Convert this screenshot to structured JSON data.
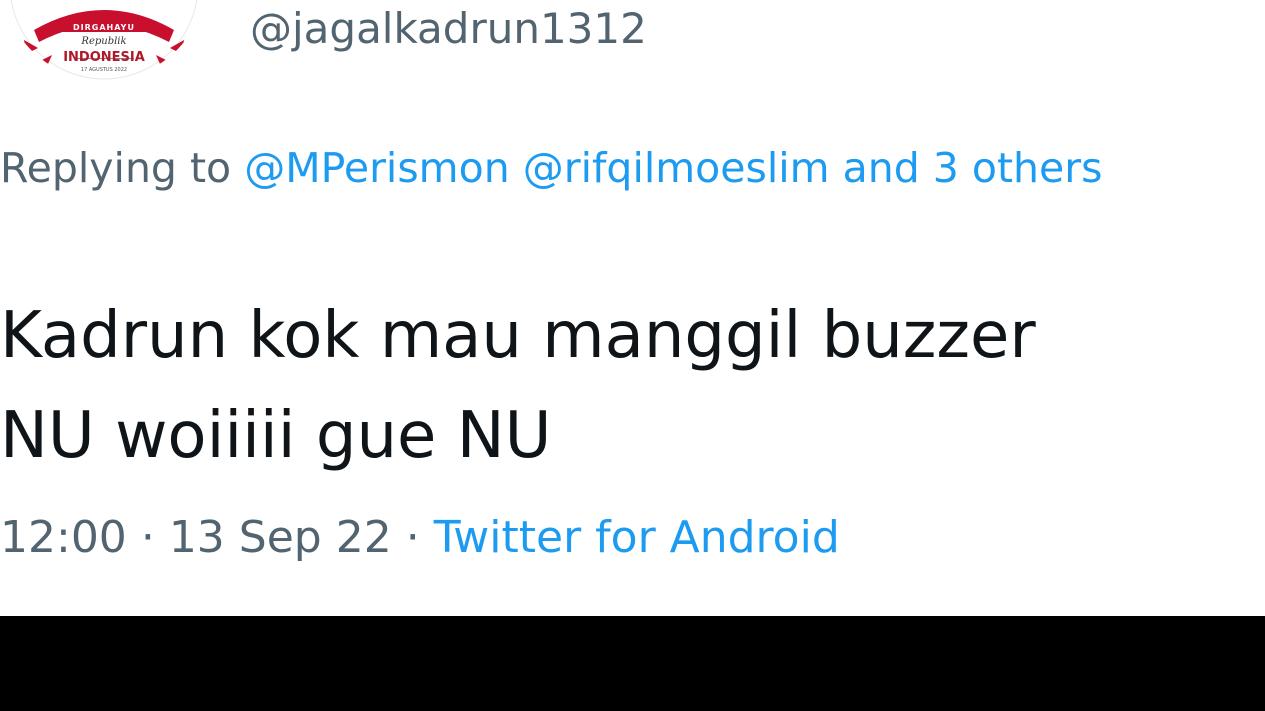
{
  "tweet": {
    "handle": "@jagalkadrun1312",
    "avatar": {
      "top_text": "DIRGAHAYU",
      "script_text": "Republik",
      "main_text": "INDONESIA",
      "date_text": "17 AGUSTUS 2022"
    },
    "replying": {
      "prefix": "Replying to",
      "mention_1": "@MPerismon",
      "mention_2": "@rifqilmoeslim",
      "others": "and 3 others"
    },
    "text_line_1": "Kadrun kok mau manggil buzzer",
    "text_line_2": "NU woiiiii gue NU",
    "time": "12:00",
    "date": "13 Sep 22",
    "separator": "·",
    "source": "Twitter for Android"
  },
  "colors": {
    "secondary_text": "#536471",
    "link": "#1d9bf0",
    "primary_text": "#0f1419",
    "background": "#ffffff",
    "letterbox": "#000000",
    "avatar_accent": "#b0182a"
  }
}
